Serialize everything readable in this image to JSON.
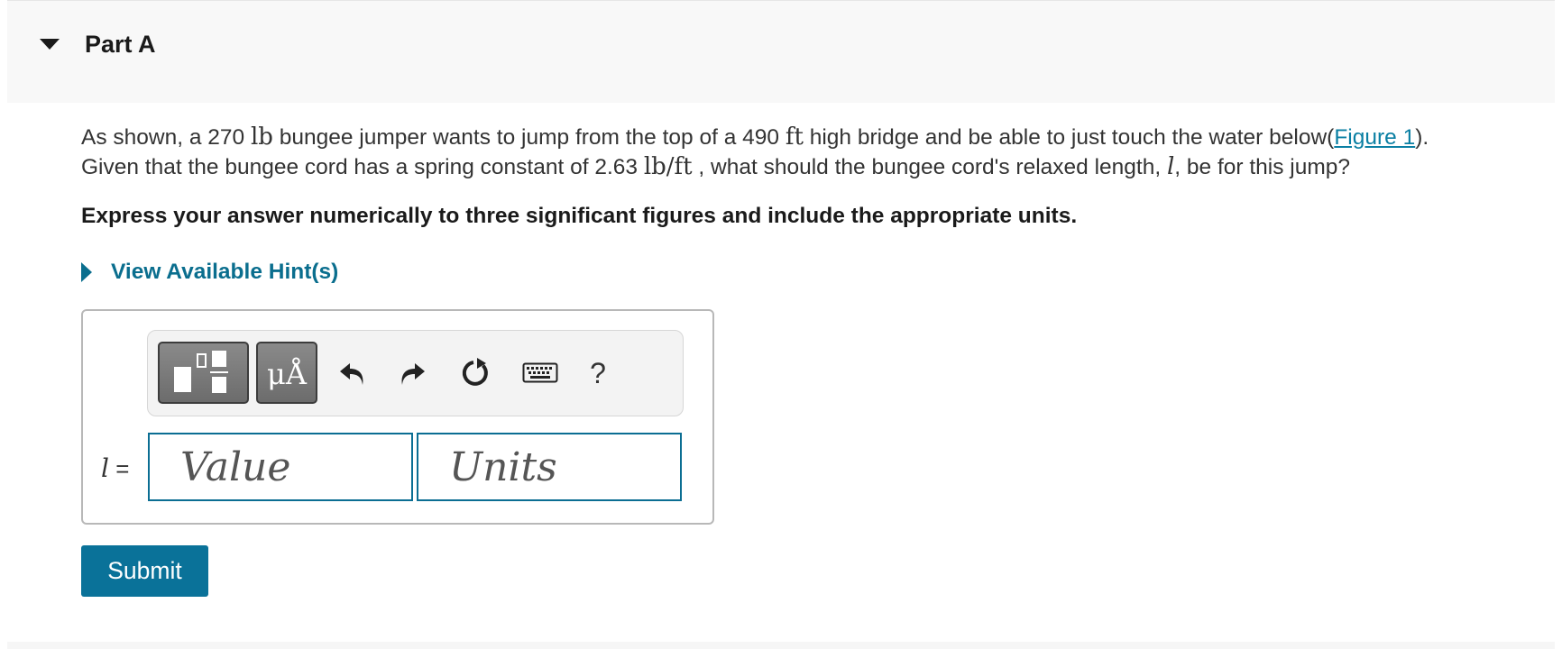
{
  "part": {
    "title": "Part A"
  },
  "question": {
    "text_1": "As shown, a 270 ",
    "unit_lb": "lb",
    "text_2": " bungee jumper wants to jump from the top of a 490 ",
    "unit_ft": "ft",
    "text_3": " high bridge and be able to just touch the water below(",
    "figure_link": "Figure 1",
    "text_4": ").",
    "text_5": "Given that the bungee cord has a spring constant of 2.63 ",
    "unit_lb_per_ft": "lb/ft",
    "text_6": " , what should the bungee cord's relaxed length, ",
    "var_l": "l",
    "text_7": ", be for this jump?"
  },
  "instruction": "Express your answer numerically to three significant figures and include the appropriate units.",
  "hint": {
    "label": "View Available Hint(s)"
  },
  "toolbar": {
    "templates_icon": "templates-icon",
    "symbols_label": "μÅ",
    "undo_icon": "undo-icon",
    "redo_icon": "redo-icon",
    "reset_icon": "reset-icon",
    "keyboard_icon": "keyboard-icon",
    "help_label": "?"
  },
  "answer": {
    "variable": "l",
    "equals": " =",
    "value_placeholder": "Value",
    "units_placeholder": "Units"
  },
  "submit_label": "Submit",
  "colors": {
    "accent": "#0a7299",
    "link": "#0a7fa3",
    "header_bg": "#f8f8f8"
  }
}
